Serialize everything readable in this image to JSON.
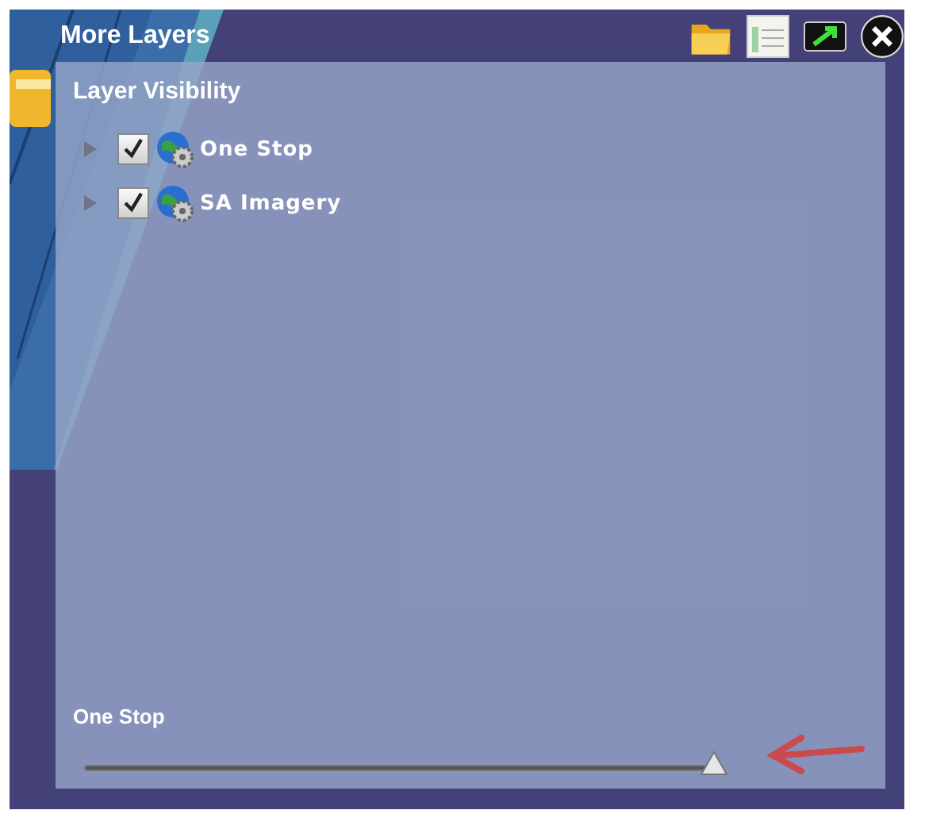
{
  "window": {
    "title": "More Layers"
  },
  "panel": {
    "title": "Layer Visibility"
  },
  "layers": [
    {
      "name": "One Stop",
      "checked": true,
      "expanded": false
    },
    {
      "name": "SA Imagery",
      "checked": true,
      "expanded": false
    }
  ],
  "opacity": {
    "label": "One Stop",
    "level": 1.0
  }
}
